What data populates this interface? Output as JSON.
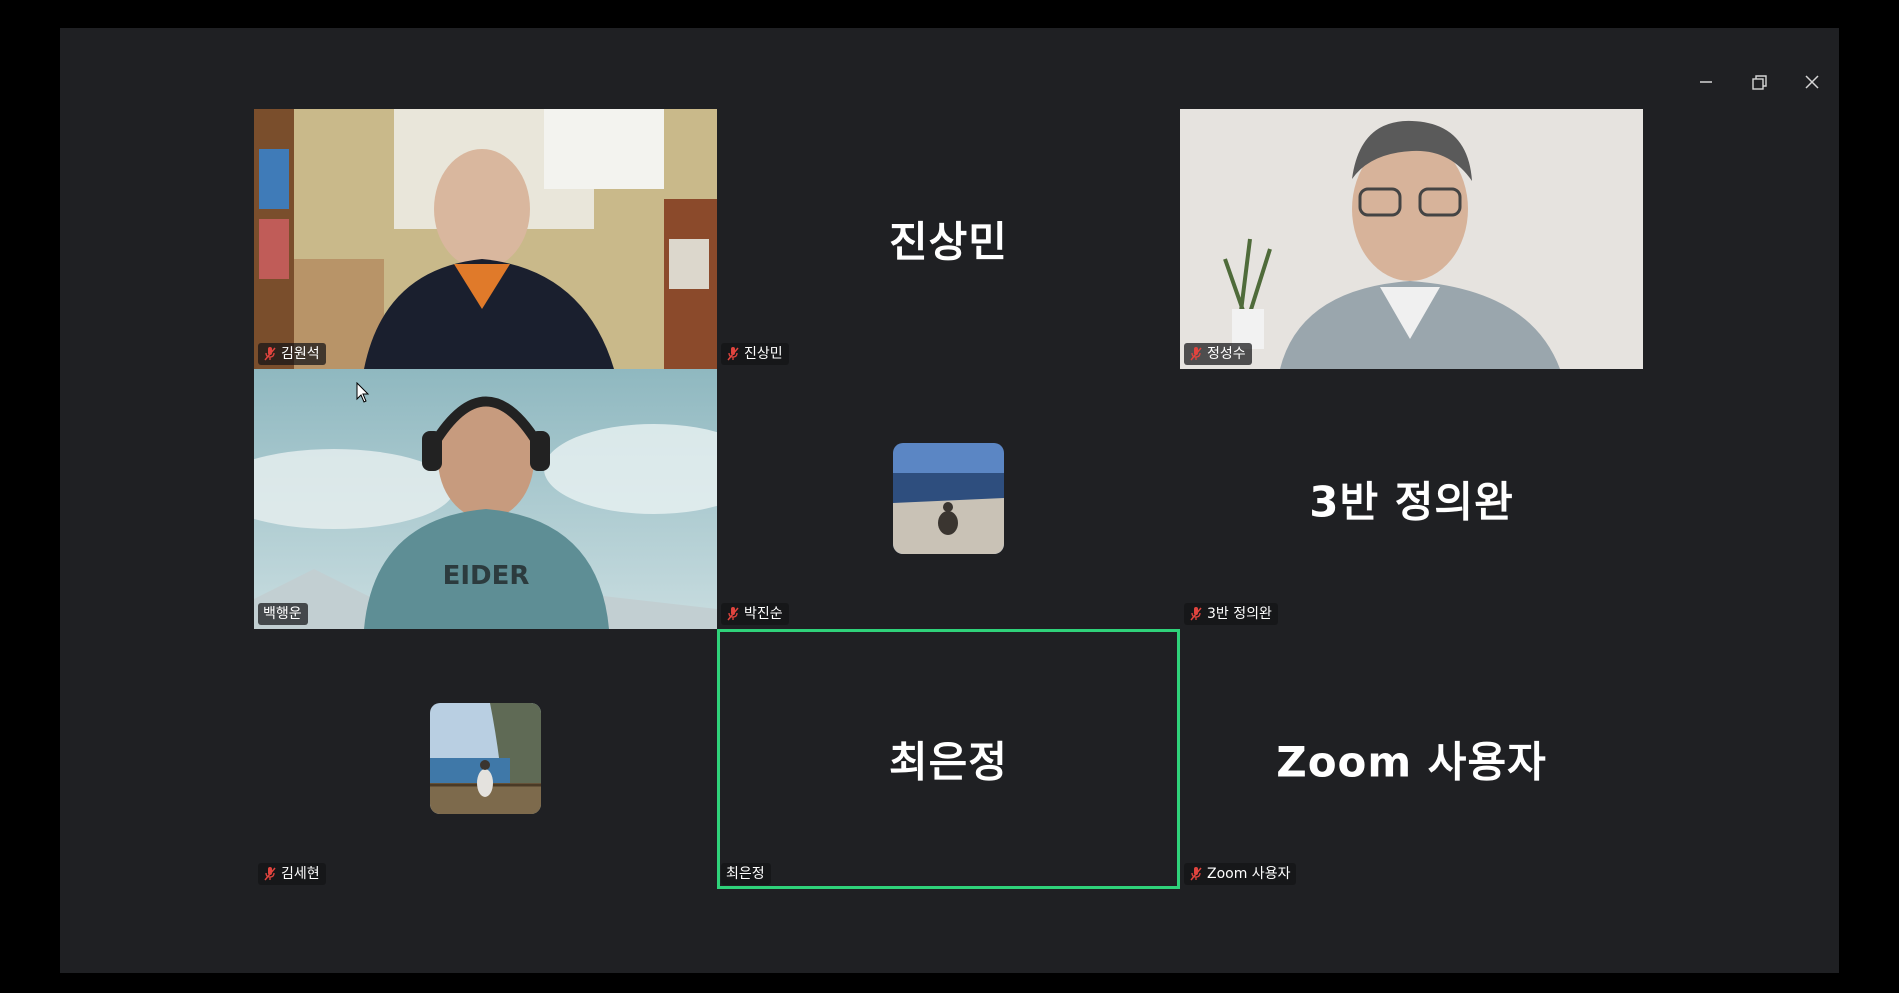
{
  "window": {
    "controls": {
      "minimize": "minimize-icon",
      "restore": "restore-icon",
      "close": "close-icon"
    }
  },
  "participants": [
    {
      "name": "김원석",
      "label": "김원석",
      "muted": true,
      "video": true
    },
    {
      "name": "진상민",
      "label": "진상민",
      "muted": true,
      "video": false,
      "display": "진상민"
    },
    {
      "name": "정성수",
      "label": "정성수",
      "muted": true,
      "video": true
    },
    {
      "name": "백행운",
      "label": "백행운",
      "muted": false,
      "video": true
    },
    {
      "name": "박진순",
      "label": "박진순",
      "muted": true,
      "video": false,
      "avatar": true
    },
    {
      "name": "3반 정의완",
      "label": "3반 정의완",
      "muted": true,
      "video": false,
      "display": "3반 정의완"
    },
    {
      "name": "김세현",
      "label": "김세현",
      "muted": true,
      "video": false,
      "avatar": true
    },
    {
      "name": "최은정",
      "label": "최은정",
      "muted": false,
      "video": false,
      "display": "최은정",
      "active_speaker": true
    },
    {
      "name": "Zoom 사용자",
      "label": "Zoom 사용자",
      "muted": true,
      "video": false,
      "display": "Zoom 사용자"
    }
  ],
  "colors": {
    "background": "#1f2023",
    "active_speaker_border": "#2fd27a",
    "muted_icon": "#e0443e"
  }
}
